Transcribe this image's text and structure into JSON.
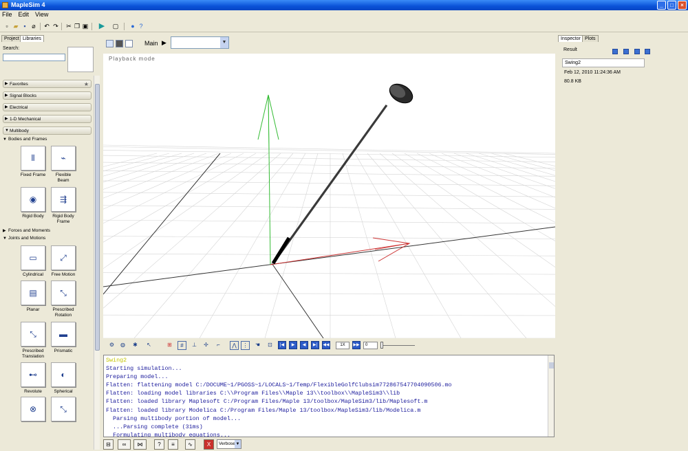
{
  "window": {
    "title": "MapleSim 4"
  },
  "menu": [
    "File",
    "Edit",
    "View"
  ],
  "left_panel": {
    "tabs": [
      "Project",
      "Libraries"
    ],
    "search_label": "Search:",
    "categories": [
      "Favorites",
      "Signal Blocks",
      "Electrical",
      "1-D Mechanical",
      "Multibody"
    ],
    "subheads": [
      "Bodies and Frames",
      "Forces and Moments",
      "Joints and Motions"
    ],
    "components": [
      {
        "label": "Fixed Frame"
      },
      {
        "label": "Flexible Beam"
      },
      {
        "label": "Rigid Body"
      },
      {
        "label": "Rigid Body Frame"
      },
      {
        "label": "Cylindrical"
      },
      {
        "label": "Free Motion"
      },
      {
        "label": "Planar"
      },
      {
        "label": "Prescribed Rotation"
      },
      {
        "label": "Prescribed Translation"
      },
      {
        "label": "Prismatic"
      },
      {
        "label": "Revolute"
      },
      {
        "label": "Spherical"
      }
    ]
  },
  "center": {
    "breadcrumb": "Main",
    "playback_mode": "Playback mode",
    "speed": "1X",
    "frame": "0"
  },
  "console": {
    "lines": [
      "Swing2",
      "Starting simulation...",
      "Preparing model...",
      "Flatten: flattening model C:/DOCUME~1/PGOSS~1/LOCALS~1/Temp/FlexibleGolfClubsim772867547704090506.mo",
      "Flatten: loading model libraries C:\\\\Program Files\\\\Maple 13\\\\toolbox\\\\MapleSim3\\\\lib",
      "Flatten: loaded library Maplesoft C:/Program Files/Maple 13/toolbox/MapleSim3/lib/Maplesoft.m",
      "Flatten: loaded library Modelica C:/Program Files/Maple 13/toolbox/MapleSim3/lib/Modelica.m",
      "  Parsing multibody portion of model...",
      "  ...Parsing complete (31ms)",
      "  Formulating multibody equations..."
    ],
    "verbosity": "Verbose"
  },
  "right_panel": {
    "tabs": [
      "Inspector",
      "Plots"
    ],
    "result_label": "Result",
    "result_name": "Swing2",
    "date": "Feb 12, 2010 11:24:36 AM",
    "size": "80.8 KB"
  }
}
